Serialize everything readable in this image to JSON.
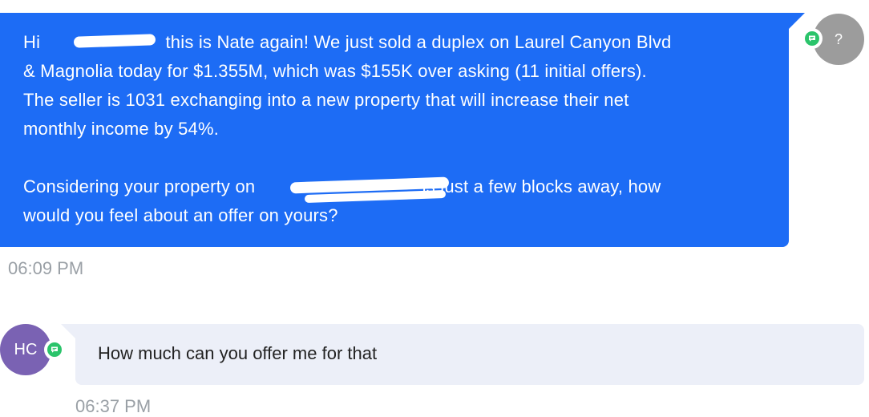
{
  "messages": {
    "outgoing": {
      "text_line1": "Hi ",
      "text_line1b": "this is Nate again! We just sold a duplex on Laurel Canyon Blvd",
      "text_line2": "& Magnolia today for $1.355M, which was $155K over asking (11 initial offers).",
      "text_line3": "The seller is 1031 exchanging into a new property that will increase their net",
      "text_line4": "monthly income by 54%.",
      "text_p2_a": "Considering your property on ",
      "text_p2_b": "is just a few blocks away, how",
      "text_p2_line2": "would you feel about an offer on yours?",
      "time": "06:09 PM",
      "avatar_text": "?"
    },
    "incoming": {
      "avatar_text": "HC",
      "text": "How much can you offer me for that",
      "time": "06:37 PM"
    }
  },
  "icons": {
    "message_badge": "chat-icon",
    "badge_color": "#2bc46b"
  },
  "colors": {
    "outgoing_bubble": "#1d6cf5",
    "incoming_bubble": "#eceff8",
    "incoming_avatar": "#7a62b3",
    "outgoing_avatar": "#9c9c9c"
  }
}
